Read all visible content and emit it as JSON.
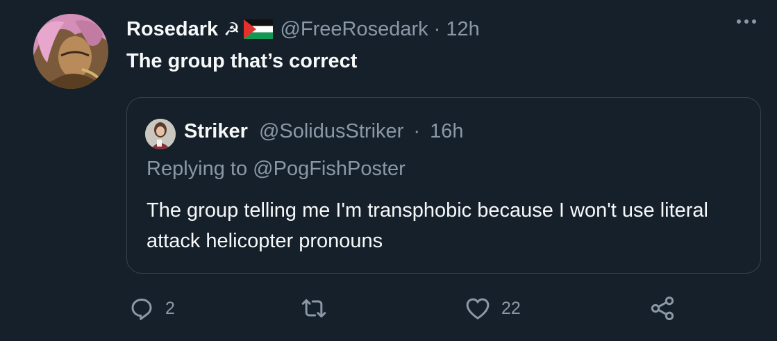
{
  "tweet": {
    "author_name": "Rosedark",
    "author_emoji": "☭",
    "author_flag": "palestine-flag",
    "author_handle": "@FreeRosedark",
    "separator": "·",
    "time": "12h",
    "text": "The group that’s correct",
    "more_icon": "more-horizontal-icon"
  },
  "quoted": {
    "author_name": "Striker",
    "author_handle": "@SolidusStriker",
    "separator": "·",
    "time": "16h",
    "reply_prefix": "Replying to",
    "reply_to": "@PogFishPoster",
    "text": "The group telling me I'm transphobic because I won't use literal attack helicopter pronouns"
  },
  "actions": {
    "reply_count": "2",
    "retweet_count": "",
    "like_count": "22",
    "icons": [
      "reply-icon",
      "retweet-icon",
      "like-icon",
      "share-icon"
    ]
  },
  "colors": {
    "background": "#15202b",
    "text_primary": "#f7f9f9",
    "text_secondary": "#8b98a5",
    "border": "#38444d"
  }
}
